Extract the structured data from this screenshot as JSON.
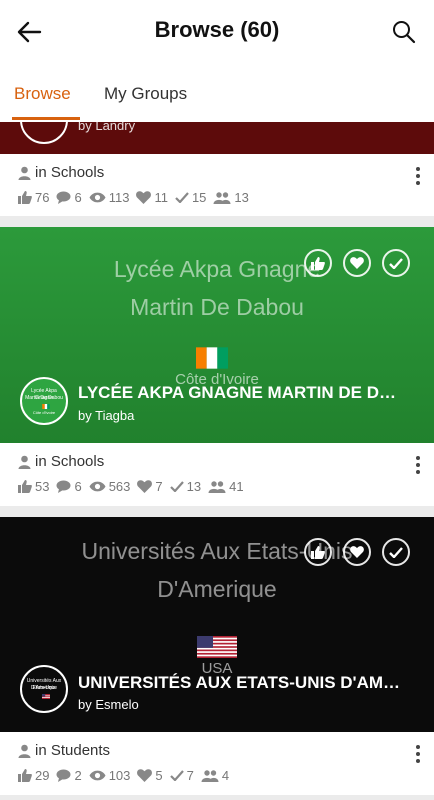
{
  "appbar": {
    "title": "Browse (60)"
  },
  "tabs": [
    {
      "label": "Browse",
      "active": true
    },
    {
      "label": "My Groups",
      "active": false
    }
  ],
  "accent_color": "#d8620f",
  "cards": [
    {
      "author": "by Landry",
      "category": "in Schools",
      "stats": {
        "likes": "76",
        "comments": "6",
        "views": "113",
        "hearts": "11",
        "checks": "15",
        "members": "13"
      }
    },
    {
      "banner_lines": [
        "Lycée Akpa Gnagne",
        "Martin De Dabou"
      ],
      "flag_label": "Côte d'Ivoire",
      "logo_lines": [
        "Lycée Akpa Gnagne",
        "Martin De Dabou",
        "Côte d'Ivoire"
      ],
      "name": "LYCÉE AKPA GNAGNE MARTIN DE DABOU",
      "author": "by Tiagba",
      "category": "in Schools",
      "stats": {
        "likes": "53",
        "comments": "6",
        "views": "563",
        "hearts": "7",
        "checks": "13",
        "members": "41"
      }
    },
    {
      "banner_lines": [
        "Universités Aux Etats-Unis",
        "D'Amerique"
      ],
      "flag_label": "USA",
      "logo_lines": [
        "Universités Aux Etats-Unis",
        "D'Amerique"
      ],
      "name": "UNIVERSITÉS AUX ETATS-UNIS D'AMERIQUE",
      "author": "by Esmelo",
      "category": "in Students",
      "stats": {
        "likes": "29",
        "comments": "2",
        "views": "103",
        "hearts": "5",
        "checks": "7",
        "members": "4"
      }
    }
  ]
}
